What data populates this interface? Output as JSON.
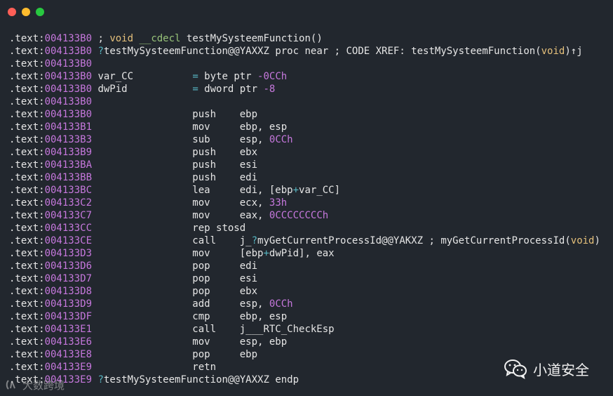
{
  "window": {
    "controls": [
      "close",
      "minimize",
      "maximize"
    ]
  },
  "colors": {
    "background": "#22272e",
    "text": "#e6e6e6",
    "address": "#c678dd",
    "number": "#c678dd",
    "type": "#e5c07b",
    "operator": "#56b6c2",
    "keyword": "#98c379"
  },
  "code_lines": [
    [
      {
        "t": ".text:",
        "c": "text"
      },
      {
        "t": "004133B0",
        "c": "addr"
      },
      {
        "t": " ; ",
        "c": "plain"
      },
      {
        "t": "void",
        "c": "type"
      },
      {
        "t": " ",
        "c": "plain"
      },
      {
        "t": "__cdecl",
        "c": "green"
      },
      {
        "t": " testMySysteemFunction()",
        "c": "plain"
      }
    ],
    [
      {
        "t": ".text:",
        "c": "text"
      },
      {
        "t": "004133B0",
        "c": "addr"
      },
      {
        "t": " ",
        "c": "plain"
      },
      {
        "t": "?",
        "c": "op"
      },
      {
        "t": "testMySysteemFunction@@YAXXZ proc near ; CODE XREF: testMySysteemFunction(",
        "c": "plain"
      },
      {
        "t": "void",
        "c": "type"
      },
      {
        "t": ")↑j",
        "c": "plain"
      }
    ],
    [
      {
        "t": ".text:",
        "c": "text"
      },
      {
        "t": "004133B0",
        "c": "addr"
      }
    ],
    [
      {
        "t": ".text:",
        "c": "text"
      },
      {
        "t": "004133B0",
        "c": "addr"
      },
      {
        "t": " var_CC          ",
        "c": "plain"
      },
      {
        "t": "=",
        "c": "op"
      },
      {
        "t": " byte ptr ",
        "c": "plain"
      },
      {
        "t": "-0CCh",
        "c": "num"
      }
    ],
    [
      {
        "t": ".text:",
        "c": "text"
      },
      {
        "t": "004133B0",
        "c": "addr"
      },
      {
        "t": " dwPid           ",
        "c": "plain"
      },
      {
        "t": "=",
        "c": "op"
      },
      {
        "t": " dword ptr ",
        "c": "plain"
      },
      {
        "t": "-8",
        "c": "num"
      }
    ],
    [
      {
        "t": ".text:",
        "c": "text"
      },
      {
        "t": "004133B0",
        "c": "addr"
      }
    ],
    [
      {
        "t": ".text:",
        "c": "text"
      },
      {
        "t": "004133B0",
        "c": "addr"
      },
      {
        "t": "                 push    ebp",
        "c": "plain"
      }
    ],
    [
      {
        "t": ".text:",
        "c": "text"
      },
      {
        "t": "004133B1",
        "c": "addr"
      },
      {
        "t": "                 mov     ebp, esp",
        "c": "plain"
      }
    ],
    [
      {
        "t": ".text:",
        "c": "text"
      },
      {
        "t": "004133B3",
        "c": "addr"
      },
      {
        "t": "                 sub     esp, ",
        "c": "plain"
      },
      {
        "t": "0CCh",
        "c": "num"
      }
    ],
    [
      {
        "t": ".text:",
        "c": "text"
      },
      {
        "t": "004133B9",
        "c": "addr"
      },
      {
        "t": "                 push    ebx",
        "c": "plain"
      }
    ],
    [
      {
        "t": ".text:",
        "c": "text"
      },
      {
        "t": "004133BA",
        "c": "addr"
      },
      {
        "t": "                 push    esi",
        "c": "plain"
      }
    ],
    [
      {
        "t": ".text:",
        "c": "text"
      },
      {
        "t": "004133BB",
        "c": "addr"
      },
      {
        "t": "                 push    edi",
        "c": "plain"
      }
    ],
    [
      {
        "t": ".text:",
        "c": "text"
      },
      {
        "t": "004133BC",
        "c": "addr"
      },
      {
        "t": "                 lea     edi, [ebp",
        "c": "plain"
      },
      {
        "t": "+",
        "c": "op"
      },
      {
        "t": "var_CC]",
        "c": "plain"
      }
    ],
    [
      {
        "t": ".text:",
        "c": "text"
      },
      {
        "t": "004133C2",
        "c": "addr"
      },
      {
        "t": "                 mov     ecx, ",
        "c": "plain"
      },
      {
        "t": "33h",
        "c": "num"
      }
    ],
    [
      {
        "t": ".text:",
        "c": "text"
      },
      {
        "t": "004133C7",
        "c": "addr"
      },
      {
        "t": "                 mov     eax, ",
        "c": "plain"
      },
      {
        "t": "0CCCCCCCCh",
        "c": "num"
      }
    ],
    [
      {
        "t": ".text:",
        "c": "text"
      },
      {
        "t": "004133CC",
        "c": "addr"
      },
      {
        "t": "                 rep stosd",
        "c": "plain"
      }
    ],
    [
      {
        "t": ".text:",
        "c": "text"
      },
      {
        "t": "004133CE",
        "c": "addr"
      },
      {
        "t": "                 call    j_",
        "c": "plain"
      },
      {
        "t": "?",
        "c": "op"
      },
      {
        "t": "myGetCurrentProcessId@@YAKXZ ; myGetCurrentProcessId(",
        "c": "plain"
      },
      {
        "t": "void",
        "c": "type"
      },
      {
        "t": ")",
        "c": "plain"
      }
    ],
    [
      {
        "t": ".text:",
        "c": "text"
      },
      {
        "t": "004133D3",
        "c": "addr"
      },
      {
        "t": "                 mov     [ebp",
        "c": "plain"
      },
      {
        "t": "+",
        "c": "op"
      },
      {
        "t": "dwPid], eax",
        "c": "plain"
      }
    ],
    [
      {
        "t": ".text:",
        "c": "text"
      },
      {
        "t": "004133D6",
        "c": "addr"
      },
      {
        "t": "                 pop     edi",
        "c": "plain"
      }
    ],
    [
      {
        "t": ".text:",
        "c": "text"
      },
      {
        "t": "004133D7",
        "c": "addr"
      },
      {
        "t": "                 pop     esi",
        "c": "plain"
      }
    ],
    [
      {
        "t": ".text:",
        "c": "text"
      },
      {
        "t": "004133D8",
        "c": "addr"
      },
      {
        "t": "                 pop     ebx",
        "c": "plain"
      }
    ],
    [
      {
        "t": ".text:",
        "c": "text"
      },
      {
        "t": "004133D9",
        "c": "addr"
      },
      {
        "t": "                 add     esp, ",
        "c": "plain"
      },
      {
        "t": "0CCh",
        "c": "num"
      }
    ],
    [
      {
        "t": ".text:",
        "c": "text"
      },
      {
        "t": "004133DF",
        "c": "addr"
      },
      {
        "t": "                 cmp     ebp, esp",
        "c": "plain"
      }
    ],
    [
      {
        "t": ".text:",
        "c": "text"
      },
      {
        "t": "004133E1",
        "c": "addr"
      },
      {
        "t": "                 call    j___RTC_CheckEsp",
        "c": "plain"
      }
    ],
    [
      {
        "t": ".text:",
        "c": "text"
      },
      {
        "t": "004133E6",
        "c": "addr"
      },
      {
        "t": "                 mov     esp, ebp",
        "c": "plain"
      }
    ],
    [
      {
        "t": ".text:",
        "c": "text"
      },
      {
        "t": "004133E8",
        "c": "addr"
      },
      {
        "t": "                 pop     ebp",
        "c": "plain"
      }
    ],
    [
      {
        "t": ".text:",
        "c": "text"
      },
      {
        "t": "004133E9",
        "c": "addr"
      },
      {
        "t": "                 retn",
        "c": "plain"
      }
    ],
    [
      {
        "t": ".text:",
        "c": "text"
      },
      {
        "t": "004133E9",
        "c": "addr"
      },
      {
        "t": " ",
        "c": "plain"
      },
      {
        "t": "?",
        "c": "op"
      },
      {
        "t": "testMySysteemFunction@@YAXXZ endp",
        "c": "plain"
      }
    ]
  ],
  "watermarks": {
    "right_text": "小道安全",
    "right_icon": "wechat-icon",
    "left_text": "大数跨境",
    "left_icon": "logo-icon"
  }
}
